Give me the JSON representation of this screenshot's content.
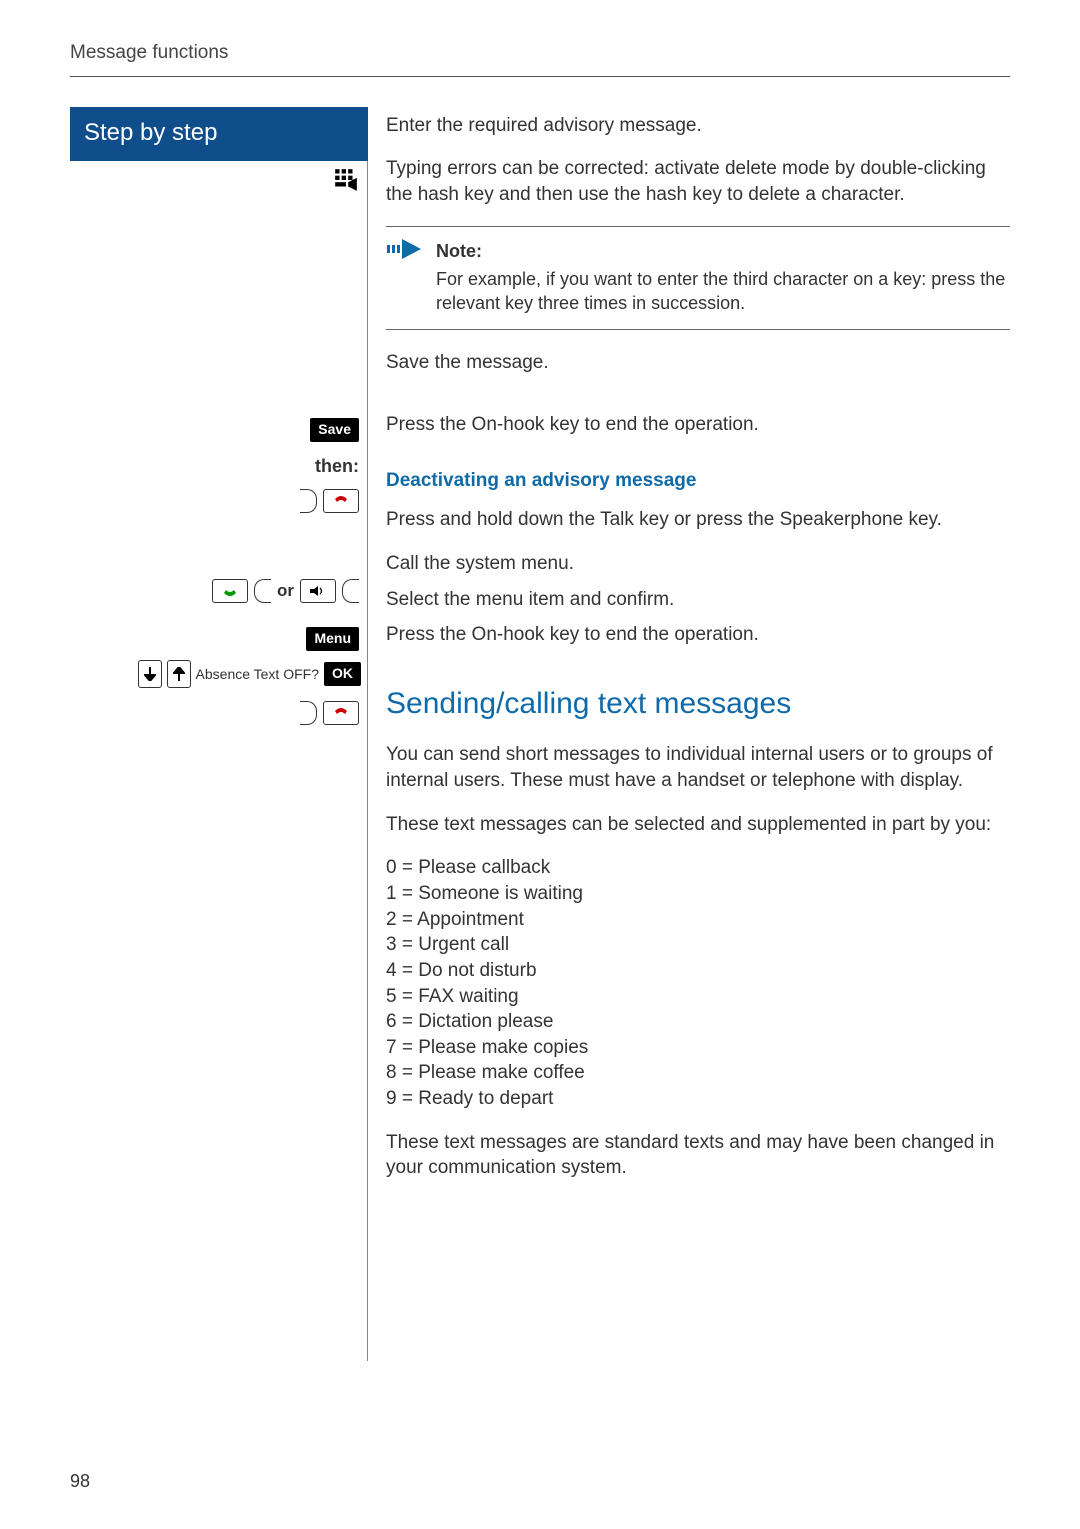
{
  "pageNumber": "98",
  "runningHead": "Message functions",
  "stepByStep": "Step by step",
  "left": {
    "saveKey": "Save",
    "thenLabel": "then:",
    "orLabel": "or",
    "menuKey": "Menu",
    "absenceText": "Absence Text OFF?",
    "okKey": "OK"
  },
  "body": {
    "enterAdvisory": "Enter the required advisory message.",
    "typingErrors": "Typing errors can be corrected: activate delete mode by double-clicking the hash key and then use the hash key to delete a character.",
    "noteTitle": "Note:",
    "noteBody": "For example, if you want to enter the third character on a key: press the relevant key three times in succession.",
    "saveMsg": "Save the message.",
    "pressOnHook": "Press the On-hook key to end the operation.",
    "deactivateHead": "Deactivating an advisory message",
    "pressTalk": "Press and hold down the Talk key or press the Speakerphone key.",
    "callMenu": "Call the system menu.",
    "selectConfirm": "Select the menu item and confirm.",
    "sendingHead": "Sending/calling text messages",
    "sendingIntro": "You can send short messages to individual internal users or to groups of internal users. These must have a handset or telephone with display.",
    "supplementIntro": "These text messages can be selected and supplemented in part by you:",
    "msgList": [
      "0 = Please callback",
      "1 = Someone is waiting",
      "2 = Appointment",
      "3 = Urgent call",
      "4 = Do not disturb",
      "5 = FAX waiting",
      "6 = Dictation please",
      "7 = Please make copies",
      "8 = Please make coffee",
      "9 = Ready to depart"
    ],
    "standardTexts": "These text messages are standard texts and may have been changed in your communication system."
  }
}
